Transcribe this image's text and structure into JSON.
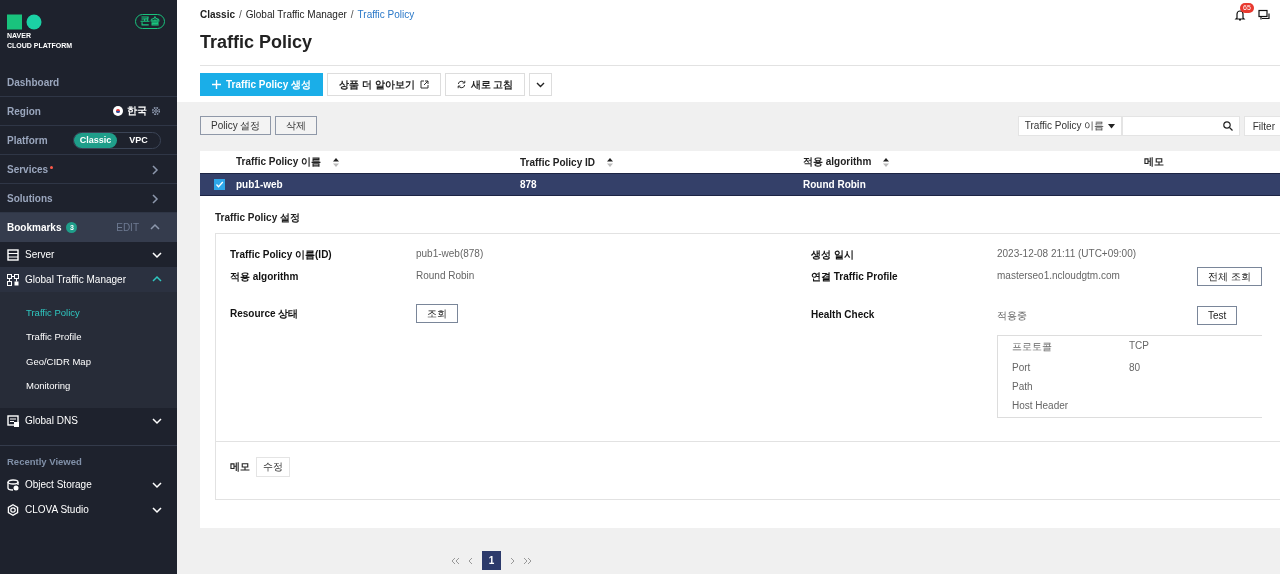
{
  "sidebar": {
    "logo": {
      "line_1": "NAVER",
      "line_2": "CLOUD PLATFORM"
    },
    "console_badge": "콘솔",
    "nav": [
      {
        "kind": "link",
        "label": "Dashboard"
      },
      {
        "kind": "region",
        "label": "Region",
        "value": "한국"
      },
      {
        "kind": "platform",
        "label": "Platform",
        "options": [
          {
            "label": "Classic",
            "selected": true
          },
          {
            "label": "VPC",
            "selected": false
          }
        ]
      },
      {
        "kind": "menu",
        "label": "Services",
        "alert": true
      },
      {
        "kind": "menu",
        "label": "Solutions",
        "alert": false
      }
    ],
    "bookmarks": {
      "label": "Bookmarks",
      "count": "3",
      "edit": "EDIT",
      "expanded": true,
      "items": [
        {
          "label": "Server",
          "expanded": false
        },
        {
          "label": "Global Traffic Manager",
          "expanded": true,
          "children": [
            {
              "label": "Traffic Policy",
              "selected": true
            },
            {
              "label": "Traffic Profile",
              "selected": false
            },
            {
              "label": "Geo/CIDR Map",
              "selected": false
            },
            {
              "label": "Monitoring",
              "selected": false
            }
          ]
        },
        {
          "label": "Global DNS",
          "expanded": false
        }
      ]
    },
    "recently_viewed": {
      "label": "Recently Viewed",
      "items": [
        {
          "label": "Object Storage",
          "expanded": false
        },
        {
          "label": "CLOVA Studio",
          "expanded": false
        }
      ]
    }
  },
  "header": {
    "breadcrumb": [
      {
        "label": "Classic",
        "separator": "/",
        "selected": false
      },
      {
        "label": "Global Traffic Manager",
        "separator": "/",
        "selected": false
      },
      {
        "label": "Traffic Policy",
        "selected": true
      }
    ],
    "notification_count": "65",
    "title": "Traffic Policy"
  },
  "actions": [
    {
      "kind": "primary",
      "label": "Traffic Policy 생성"
    },
    {
      "kind": "external",
      "label": "상품 더 알아보기"
    },
    {
      "kind": "refresh",
      "label": "새로 고침"
    },
    {
      "kind": "more"
    }
  ],
  "toolbar": {
    "buttons": [
      "Policy 설정",
      "삭제"
    ],
    "search_select": "Traffic Policy 이름",
    "filter": "Filter"
  },
  "table": {
    "columns": [
      {
        "label": "Traffic Policy 이름",
        "sortable": true
      },
      {
        "label": "Traffic Policy ID",
        "sortable": true
      },
      {
        "label": "적용 algorithm",
        "sortable": true
      },
      {
        "label": "메모",
        "sortable": false
      }
    ],
    "rows": [
      {
        "selected": true,
        "cells": [
          "pub1-web",
          "878",
          "Round Robin"
        ]
      }
    ]
  },
  "detail": {
    "title": "Traffic Policy 설정",
    "left": [
      {
        "label": "Traffic Policy 이름(ID)",
        "value": "pub1-web(878)"
      },
      {
        "label": "적용 algorithm",
        "value": "Round Robin"
      },
      {
        "label": "Resource 상태",
        "button": "조회"
      }
    ],
    "right": [
      {
        "label": "생성 일시",
        "value": "2023-12-08 21:11 (UTC+09:00)"
      },
      {
        "label": "연결 Traffic Profile",
        "value": "masterseo1.ncloudgtm.com",
        "button": "전체 조회"
      },
      {
        "label": "Health Check",
        "value": "적용중",
        "button": "Test"
      }
    ],
    "health_check": [
      {
        "name": "프로토콜",
        "value": "TCP"
      },
      {
        "name": "Port",
        "value": "80"
      },
      {
        "name": "Path"
      },
      {
        "name": "Host Header"
      }
    ],
    "memo": {
      "label": "메모",
      "button": "수정"
    }
  },
  "pagination": {
    "pages": [
      {
        "label": "1",
        "selected": true
      }
    ]
  }
}
